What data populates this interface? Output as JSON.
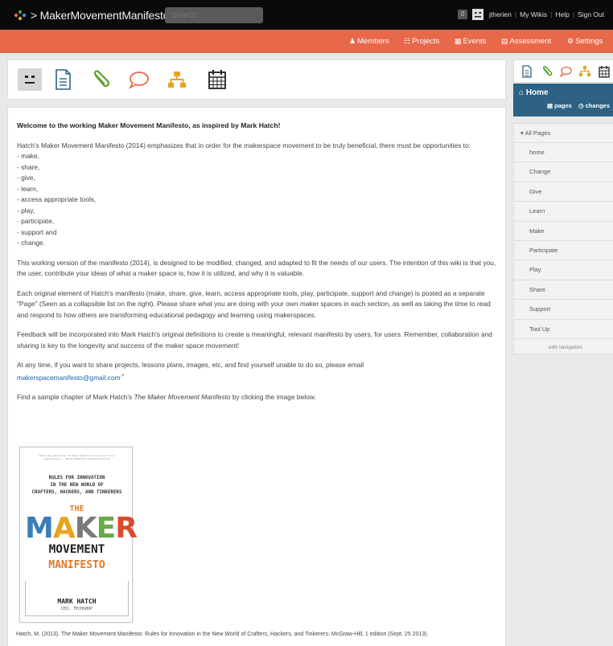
{
  "topbar": {
    "site_title": "> MakerMovementManifesto",
    "search_placeholder": "Search",
    "notification_count": "0",
    "username": "jtherien",
    "my_wikis": "My Wikis",
    "help": "Help",
    "sign_out": "Sign Out"
  },
  "orange_nav": {
    "members": "Members",
    "projects": "Projects",
    "events": "Events",
    "assessment": "Assessment",
    "settings": "Settings"
  },
  "colors": {
    "topbar": "#0a0a0a",
    "orange": "#e8684a",
    "home_blue": "#2d6284",
    "link": "#1a64b0",
    "icon_orange": "#e8684a",
    "icon_green": "#5aa02c"
  },
  "content": {
    "heading": "Welcome to the working Maker Movement Manifesto, as inspired by Mark Hatch!",
    "intro": "Hatch's Maker Movement Manifesto (2014) emphasizes that in order for the makerspace movement to be truly beneficial, there must be opportunities to:",
    "list": [
      "- make,",
      "- share,",
      "- give,",
      "- learn,",
      "- access appropriate tools,",
      "- play,",
      "- participate,",
      "- support and",
      "- change."
    ],
    "para2": "This working version of the manifesto (2014), is designed to be modified, changed, and adapted to fit the needs of our users. The intention of this wiki is that you, the user, contribute your ideas of what a maker space is, how it is utilized, and why it is valuable.",
    "para3": "Each original element of Hatch's manifesto (make, share, give, learn, access appropriate tools, play, participate, support and change) is posted as a separate \"Page\" (Seen as a collapsible list on the right). Please share what you are doing with your own maker spaces in each section, as well as taking the time to read and respond to how others are transforming educational pedagogy and learning using makerspaces.",
    "para4": "Feedback will be incorporated into Mark Hatch's original definitions to create a meaningful, relevant manifesto by users, for users. Remember, collaboration and sharing is key to the longevity and success of the maker space movement!",
    "para5": "At any time, if you want to share projects, lessons plans, images, etc, and find yourself unable to do so, please email",
    "email": "makerspacemanifesto@gmail.com",
    "para6_pre": "Find a sample chapter of Mark Hatch's ",
    "para6_title": "The Maker Movement Manifesto",
    "para6_post": " by clicking the image below.",
    "citation": "Hatch, M. (2013). The Maker Movement Manifesto: Rules for Innovation in the New World of Crafters, Hackers, and Tinkerers: McGraw-Hill; 1 edition (Sept. 25 2013)."
  },
  "book": {
    "quote": "\"Mark is the perfect guide. The Maker Movement is an important for our collective future.\" — BETH COMSTOCK, CMO AND SVP, GE",
    "tagline1": "RULES FOR INNOVATION",
    "tagline2": "IN THE NEW WORLD OF",
    "tagline3": "CRAFTERS, HACKERS, AND TINKERERS",
    "the": "THE",
    "maker_letters": [
      "M",
      "A",
      "K",
      "E",
      "R"
    ],
    "maker_colors": [
      "#3a7db8",
      "#e8a321",
      "#7a7a7a",
      "#6aa94a",
      "#d94b2b"
    ],
    "movement": "MOVEMENT",
    "manifesto": "MANIFESTO",
    "author": "MARK HATCH",
    "role": "CEO, TECHSHOP"
  },
  "sidebar": {
    "home_title": "Home",
    "pages_link": "pages",
    "changes_link": "changes",
    "all_pages": "All Pages",
    "items": [
      "home",
      "Change",
      "Give",
      "Learn",
      "Make",
      "Participate",
      "Play",
      "Share",
      "Support",
      "Tool Up"
    ],
    "edit_navigation": "edit navigation"
  }
}
